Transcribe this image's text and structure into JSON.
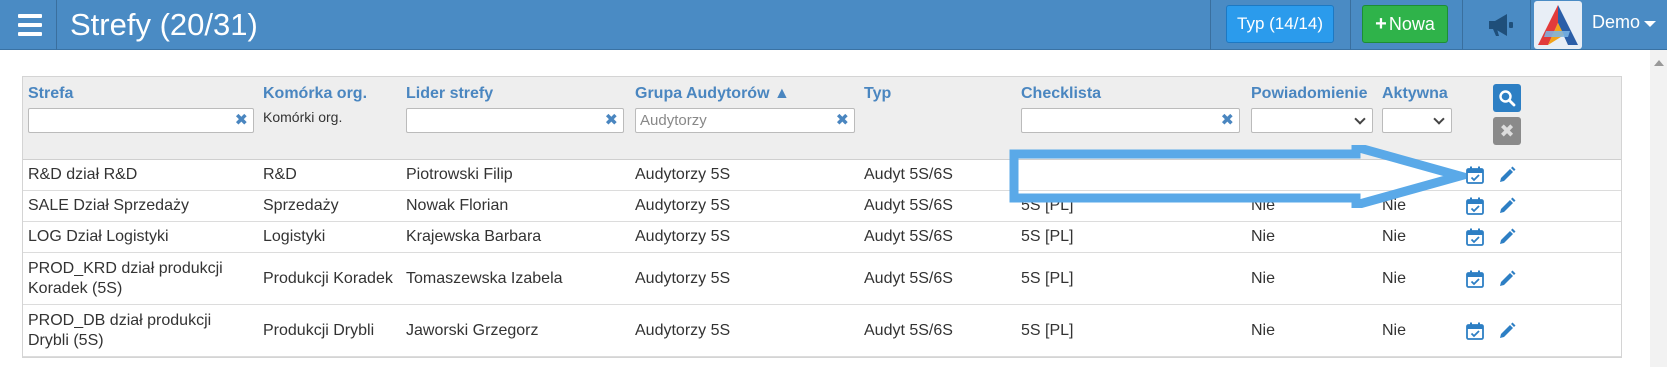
{
  "header": {
    "title": "Strefy (20/31)",
    "type_button": "Typ (14/14)",
    "new_button": "Nowa",
    "user": "Demo"
  },
  "columns": {
    "strefa": "Strefa",
    "komorka": "Komórka org.",
    "lider": "Lider strefy",
    "grupa": "Grupa Audytorów ▲",
    "typ": "Typ",
    "checklista": "Checklista",
    "powiadomienie": "Powiadomienie",
    "aktywna": "Aktywna"
  },
  "filters": {
    "komorka_text": "Komórki org.",
    "grupa_placeholder": "Audytorzy"
  },
  "rows": [
    {
      "strefa": "R&D dział R&D",
      "komorka": "R&D",
      "lider": "Piotrowski Filip",
      "grupa": "Audytorzy 5S",
      "typ": "Audyt 5S/6S",
      "checklista": "",
      "powiadomienie": "",
      "aktywna": ""
    },
    {
      "strefa": "SALE Dział Sprzedaży",
      "komorka": "Sprzedaży",
      "lider": "Nowak Florian",
      "grupa": "Audytorzy 5S",
      "typ": "Audyt 5S/6S",
      "checklista": "5S [PL]",
      "powiadomienie": "Nie",
      "aktywna": "Nie"
    },
    {
      "strefa": "LOG Dział Logistyki",
      "komorka": "Logistyki",
      "lider": "Krajewska Barbara",
      "grupa": "Audytorzy 5S",
      "typ": "Audyt 5S/6S",
      "checklista": "5S [PL]",
      "powiadomienie": "Nie",
      "aktywna": "Nie"
    },
    {
      "strefa": "PROD_KRD dział produkcji Koradek (5S)",
      "komorka": "Produkcji Koradek",
      "lider": "Tomaszewska Izabela",
      "grupa": "Audytorzy 5S",
      "typ": "Audyt 5S/6S",
      "checklista": "5S [PL]",
      "powiadomienie": "Nie",
      "aktywna": "Nie"
    },
    {
      "strefa": "PROD_DB dział produkcji Drybli (5S)",
      "komorka": "Produkcji Drybli",
      "lider": "Jaworski Grzegorz",
      "grupa": "Audytorzy 5S",
      "typ": "Audyt 5S/6S",
      "checklista": "5S [PL]",
      "powiadomienie": "Nie",
      "aktywna": "Nie"
    }
  ],
  "icons": {
    "menu": "hamburger-menu-icon",
    "announce": "megaphone-icon",
    "search": "search-icon",
    "clear": "close-icon",
    "calendar": "calendar-check-icon",
    "edit": "pencil-icon"
  },
  "colors": {
    "topbar": "#4a8bc4",
    "type_button": "#2b9bec",
    "new_button": "#2fb34a",
    "column_header": "#4a86c0",
    "annotation_arrow": "#5aa9e8"
  }
}
